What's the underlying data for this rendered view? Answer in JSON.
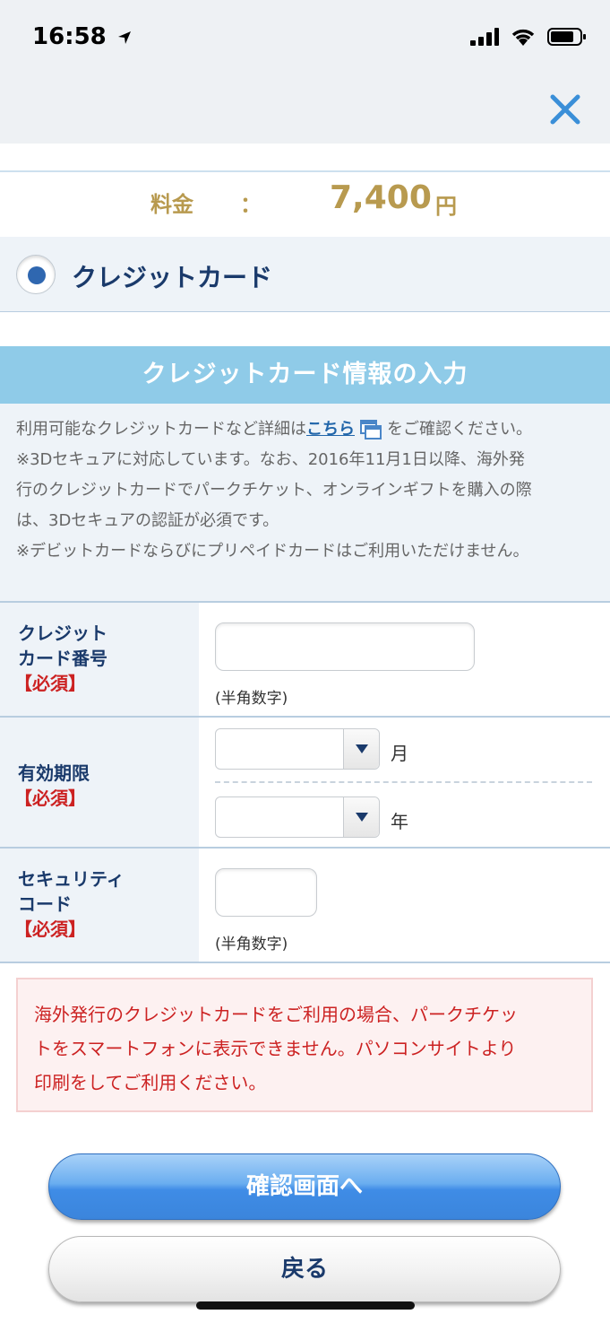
{
  "status_bar": {
    "time": "16:58"
  },
  "price": {
    "label": "料金",
    "colon": "：",
    "value": "7,400",
    "unit": "円"
  },
  "payment_method": {
    "label": "クレジットカード",
    "selected": true
  },
  "section": {
    "title": "クレジットカード情報の入力"
  },
  "info": {
    "line1_before": "利用可能なクレジットカードなど詳細は",
    "line1_link": "こちら",
    "line1_after": "をご確認ください。",
    "line2": "※3Dセキュアに対応しています。なお、2016年11月1日以降、海外発",
    "line3": "行のクレジットカードでパークチケット、オンラインギフトを購入の際",
    "line4": "は、3Dセキュアの認証が必須です。",
    "line5": "※デビットカードならびにプリペイドカードはご利用いただけません。"
  },
  "form": {
    "card_number": {
      "label_line1": "クレジット",
      "label_line2": "カード番号",
      "required": "【必須】",
      "value": "",
      "hint": "(半角数字)"
    },
    "expiry": {
      "label": "有効期限",
      "required": "【必須】",
      "month_value": "",
      "month_unit": "月",
      "year_value": "",
      "year_unit": "年"
    },
    "security_code": {
      "label_line1": "セキュリティ",
      "label_line2": "コード",
      "required": "【必須】",
      "value": "",
      "hint": "(半角数字)"
    }
  },
  "warning": {
    "line1": "海外発行のクレジットカードをご利用の場合、パークチケッ",
    "line2": "トをスマートフォンに表示できません。パソコンサイトより",
    "line3": "印刷をしてご利用ください。"
  },
  "buttons": {
    "confirm": "確認画面へ",
    "back": "戻る"
  },
  "colors": {
    "accent": "#2f67b0",
    "price": "#b89a4f",
    "header": "#8fcbe8",
    "warning": "#cc2222"
  }
}
